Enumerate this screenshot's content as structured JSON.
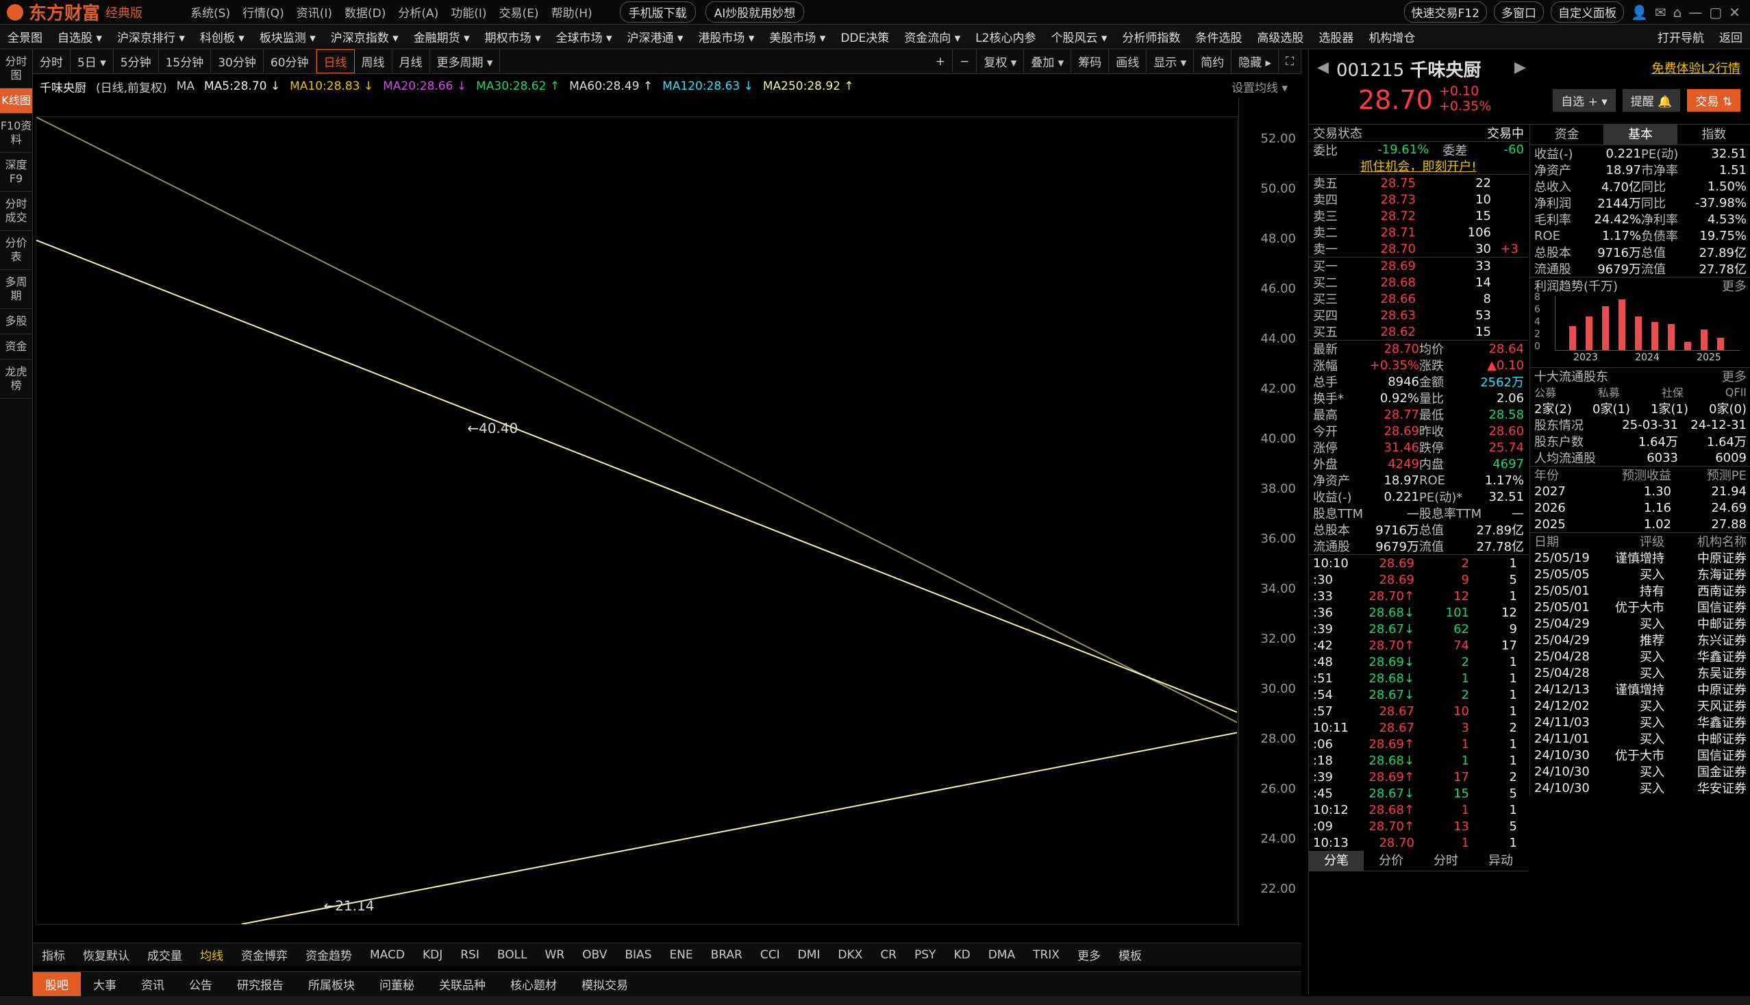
{
  "app": {
    "logo": "东方财富",
    "edition": "经典版"
  },
  "sysmenu": [
    "系统(S)",
    "行情(Q)",
    "资讯(I)",
    "数据(D)",
    "分析(A)",
    "功能(I)",
    "交易(E)",
    "帮助(H)"
  ],
  "top_buttons": [
    "手机版下载",
    "AI炒股就用妙想"
  ],
  "top_right": [
    "快速交易F12",
    "多窗口",
    "自定义面板"
  ],
  "nav": [
    "全景图",
    "自选股 ▾",
    "沪深京排行 ▾",
    "科创板 ▾",
    "板块监测 ▾",
    "沪深京指数 ▾",
    "金融期货 ▾",
    "期权市场 ▾",
    "全球市场 ▾",
    "沪深港通 ▾",
    "港股市场 ▾",
    "美股市场 ▾",
    "DDE决策",
    "资金流向 ▾",
    "L2核心内参",
    "个股风云 ▾",
    "分析师指数",
    "条件选股",
    "高级选股",
    "选股器",
    "机构增仓"
  ],
  "nav_right": [
    "打开导航",
    "返回"
  ],
  "side": [
    "分时图",
    "K线图",
    "F10资料",
    "深度F9",
    "分时成交",
    "分价表",
    "多周期",
    "多股",
    "资金",
    "龙虎榜"
  ],
  "toolbar": [
    "分时",
    "5日 ▾",
    "5分钟",
    "15分钟",
    "30分钟",
    "60分钟",
    "日线",
    "周线",
    "月线",
    "更多周期 ▾"
  ],
  "toolbar_right": [
    "+",
    "−",
    "复权 ▾",
    "叠加 ▾",
    "筹码",
    "画线",
    "显示 ▾",
    "简约",
    "隐藏 ▸",
    "⛶"
  ],
  "ma": {
    "name": "千味央厨",
    "mode": "(日线,前复权)",
    "label": "MA",
    "ma5": "MA5:28.70 ↓",
    "ma10": "MA10:28.83 ↓",
    "ma20": "MA20:28.66 ↓",
    "ma30": "MA30:28.62 ↑",
    "ma60": "MA60:28.49 ↑",
    "ma120": "MA120:28.63 ↓",
    "ma250": "MA250:28.92 ↑",
    "settings": "设置均线 ▾"
  },
  "yaxis": [
    "52.00",
    "50.00",
    "48.00",
    "46.00",
    "44.00",
    "42.00",
    "40.00",
    "38.00",
    "36.00",
    "34.00",
    "32.00",
    "30.00",
    "28.00",
    "26.00",
    "24.00",
    "22.00"
  ],
  "chart_labels": {
    "high": "←40.40",
    "low": "←21.14"
  },
  "indicators": [
    "指标",
    "恢复默认",
    "成交量",
    "均线",
    "资金博弈",
    "资金趋势",
    "MACD",
    "KDJ",
    "RSI",
    "BOLL",
    "WR",
    "OBV",
    "BIAS",
    "ENE",
    "BRAR",
    "CCI",
    "DMI",
    "DKX",
    "CR",
    "PSY",
    "KD",
    "DMA",
    "TRIX",
    "更多",
    "模板"
  ],
  "bottom_tabs": [
    "股吧",
    "大事",
    "资讯",
    "公告",
    "研究报告",
    "所属板块",
    "问董秘",
    "关联品种",
    "核心题材",
    "模拟交易"
  ],
  "quote": {
    "code": "001215",
    "name": "千味央厨",
    "l2": "免费体验L2行情",
    "price": "28.70",
    "chg": "+0.10",
    "pct": "+0.35%",
    "btns": [
      "自选 + ▾",
      "提醒 🔔",
      "交易 ⇅"
    ]
  },
  "trade_state": {
    "label": "交易状态",
    "value": "交易中"
  },
  "weibi": {
    "k1": "委比",
    "v1": "-19.61%",
    "k2": "委差",
    "v2": "-60"
  },
  "open_account": "抓住机会，即刻开户!",
  "asks": [
    [
      "卖五",
      "28.75",
      "22",
      ""
    ],
    [
      "卖四",
      "28.73",
      "10",
      ""
    ],
    [
      "卖三",
      "28.72",
      "15",
      ""
    ],
    [
      "卖二",
      "28.71",
      "106",
      ""
    ],
    [
      "卖一",
      "28.70",
      "30",
      "+3"
    ]
  ],
  "bids": [
    [
      "买一",
      "28.69",
      "33"
    ],
    [
      "买二",
      "28.68",
      "14"
    ],
    [
      "买三",
      "28.66",
      "8"
    ],
    [
      "买四",
      "28.63",
      "53"
    ],
    [
      "买五",
      "28.62",
      "15"
    ]
  ],
  "stats": [
    [
      "最新",
      "28.70",
      "均价",
      "28.64"
    ],
    [
      "涨幅",
      "+0.35%",
      "涨跌",
      "▲0.10"
    ],
    [
      "总手",
      "8946",
      "金额",
      "2562万"
    ],
    [
      "换手*",
      "0.92%",
      "量比",
      "2.06"
    ],
    [
      "最高",
      "28.77",
      "最低",
      "28.58"
    ],
    [
      "今开",
      "28.69",
      "昨收",
      "28.60"
    ],
    [
      "涨停",
      "31.46",
      "跌停",
      "25.74"
    ],
    [
      "外盘",
      "4249",
      "内盘",
      "4697"
    ],
    [
      "净资产",
      "18.97",
      "ROE",
      "1.17%"
    ],
    [
      "收益(-)",
      "0.221",
      "PE(动)*",
      "32.51"
    ],
    [
      "股息TTM",
      "—",
      "股息率TTM",
      "—"
    ],
    [
      "总股本",
      "9716万",
      "总值",
      "27.89亿"
    ],
    [
      "流通股",
      "9679万",
      "流值",
      "27.78亿"
    ]
  ],
  "ticks": [
    [
      "10:10",
      "28.69",
      "2",
      "1"
    ],
    [
      ":30",
      "28.69",
      "9",
      "5"
    ],
    [
      ":33",
      "28.70↑",
      "12",
      "1"
    ],
    [
      ":36",
      "28.68↓",
      "101",
      "12"
    ],
    [
      ":39",
      "28.67↓",
      "62",
      "9"
    ],
    [
      ":42",
      "28.70↑",
      "74",
      "17"
    ],
    [
      ":48",
      "28.69↓",
      "2",
      "1"
    ],
    [
      ":51",
      "28.68↓",
      "1",
      "1"
    ],
    [
      ":54",
      "28.67↓",
      "2",
      "1"
    ],
    [
      ":57",
      "28.67",
      "10",
      "1"
    ],
    [
      "10:11",
      "28.67",
      "3",
      "2"
    ],
    [
      ":06",
      "28.69↑",
      "1",
      "1"
    ],
    [
      ":18",
      "28.68↓",
      "1",
      "1"
    ],
    [
      ":39",
      "28.69↑",
      "17",
      "2"
    ],
    [
      ":45",
      "28.67↓",
      "15",
      "5"
    ],
    [
      "10:12",
      "28.68↑",
      "1",
      "1"
    ],
    [
      ":09",
      "28.70↑",
      "13",
      "5"
    ],
    [
      "10:13",
      "28.70",
      "1",
      "1"
    ]
  ],
  "tick_tabs": [
    "分笔",
    "分价",
    "分时",
    "异动"
  ],
  "right_tabs": [
    "资金",
    "基本",
    "指数"
  ],
  "fund": [
    [
      "收益(-)",
      "0.221",
      "PE(动)",
      "32.51"
    ],
    [
      "净资产",
      "18.97",
      "市净率",
      "1.51"
    ],
    [
      "总收入",
      "4.70亿",
      "同比",
      "1.50%"
    ],
    [
      "净利润",
      "2144万",
      "同比",
      "-37.98%"
    ],
    [
      "毛利率",
      "24.42%",
      "净利率",
      "4.53%"
    ],
    [
      "ROE",
      "1.17%",
      "负债率",
      "19.75%"
    ],
    [
      "总股本",
      "9716万",
      "总值",
      "27.89亿"
    ],
    [
      "流通股",
      "9679万",
      "流值",
      "27.78亿"
    ]
  ],
  "profit": {
    "title": "利润趋势(千万)",
    "more": "更多",
    "yticks": [
      "8",
      "6",
      "4",
      "2",
      "0"
    ],
    "years": [
      "2023",
      "2024",
      "2025"
    ],
    "values": [
      3.5,
      5.0,
      6.5,
      7.5,
      5.0,
      4.2,
      3.8,
      1.2,
      3.0,
      1.8
    ]
  },
  "holders": {
    "title": "十大流通股东",
    "more": "更多",
    "heads": [
      "公募",
      "私募",
      "社保",
      "QFII"
    ],
    "vals": [
      "2家(2)",
      "0家(1)",
      "1家(1)",
      "0家(0)"
    ],
    "rows": [
      [
        "股东情况",
        "25-03-31",
        "24-12-31"
      ],
      [
        "股东户数",
        "1.64万",
        "1.64万"
      ],
      [
        "人均流通股",
        "6033",
        "6009"
      ]
    ]
  },
  "forecast": {
    "heads": [
      "年份",
      "预测收益",
      "预测PE"
    ],
    "rows": [
      [
        "2027",
        "1.30",
        "21.94"
      ],
      [
        "2026",
        "1.16",
        "24.69"
      ],
      [
        "2025",
        "1.02",
        "27.88"
      ]
    ]
  },
  "ratings": {
    "heads": [
      "日期",
      "评级",
      "机构名称"
    ],
    "rows": [
      [
        "25/05/19",
        "谨慎增持",
        "中原证券"
      ],
      [
        "25/05/05",
        "买入",
        "东海证券"
      ],
      [
        "25/05/01",
        "持有",
        "西南证券"
      ],
      [
        "25/05/01",
        "优于大市",
        "国信证券"
      ],
      [
        "25/04/29",
        "买入",
        "中邮证券"
      ],
      [
        "25/04/29",
        "推荐",
        "东兴证券"
      ],
      [
        "25/04/28",
        "买入",
        "华鑫证券"
      ],
      [
        "25/04/28",
        "买入",
        "东吴证券"
      ],
      [
        "24/12/13",
        "谨慎增持",
        "中原证券"
      ],
      [
        "24/12/02",
        "买入",
        "天风证券"
      ],
      [
        "24/11/03",
        "买入",
        "华鑫证券"
      ],
      [
        "24/11/01",
        "买入",
        "中邮证券"
      ],
      [
        "24/10/30",
        "优于大市",
        "国信证券"
      ],
      [
        "24/10/30",
        "买入",
        "国金证券"
      ],
      [
        "24/10/30",
        "买入",
        "华安证券"
      ]
    ]
  },
  "colors": {
    "accent": "#e35b25",
    "up": "#ff3b3b",
    "down": "#1ed760",
    "label": "#f0c000"
  }
}
